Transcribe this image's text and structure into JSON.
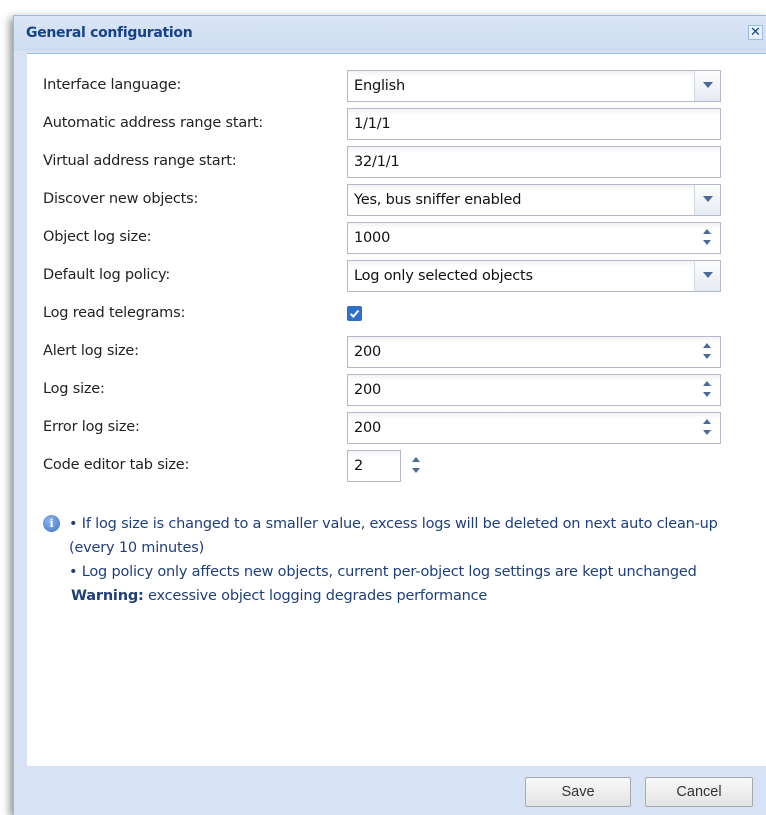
{
  "dialog": {
    "title": "General configuration",
    "close_label": "✕"
  },
  "form": {
    "interface_language": {
      "label": "Interface language:",
      "value": "English"
    },
    "auto_address_start": {
      "label": "Automatic address range start:",
      "value": "1/1/1"
    },
    "virtual_address_start": {
      "label": "Virtual address range start:",
      "value": "32/1/1"
    },
    "discover_objects": {
      "label": "Discover new objects:",
      "value": "Yes, bus sniffer enabled"
    },
    "object_log_size": {
      "label": "Object log size:",
      "value": "1000"
    },
    "default_log_policy": {
      "label": "Default log policy:",
      "value": "Log only selected objects"
    },
    "log_read_telegrams": {
      "label": "Log read telegrams:",
      "checked": true
    },
    "alert_log_size": {
      "label": "Alert log size:",
      "value": "200"
    },
    "log_size": {
      "label": "Log size:",
      "value": "200"
    },
    "error_log_size": {
      "label": "Error log size:",
      "value": "200"
    },
    "code_editor_tab_size": {
      "label": "Code editor tab size:",
      "value": "2"
    }
  },
  "info": {
    "icon": "info-icon",
    "note1": "• If log size is changed to a smaller value, excess logs will be deleted on next auto clean-up (every 10 minutes)",
    "note2": "• Log policy only affects new objects, current per-object log settings are kept unchanged",
    "warning_label": "Warning:",
    "warning_text": " excessive object logging degrades performance"
  },
  "footer": {
    "save_label": "Save",
    "cancel_label": "Cancel"
  },
  "colors": {
    "title": "#15428b",
    "panel_bg": "#d7e3f4",
    "border": "#99bbe8",
    "checkbox": "#2f6fc9",
    "info_text": "#1f3f7a"
  }
}
